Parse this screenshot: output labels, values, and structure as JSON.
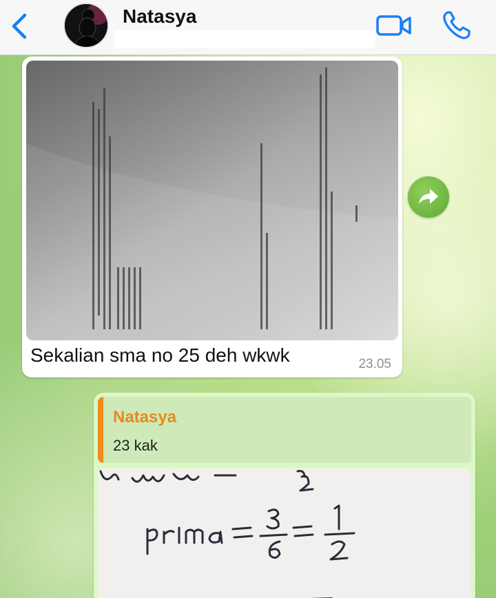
{
  "header": {
    "contact_name": "Natasya",
    "icons": {
      "back": "chevron-left-icon",
      "video": "video-call-icon",
      "phone": "phone-icon"
    },
    "accent_color": "#1a7ef5"
  },
  "messages": [
    {
      "direction": "incoming",
      "type": "photo",
      "caption": "Sekalian sma no 25 deh wkwk",
      "time": "23.05"
    },
    {
      "direction": "outgoing",
      "type": "photo",
      "reply_to": {
        "author": "Natasya",
        "text": "23 kak"
      }
    }
  ],
  "colors": {
    "outgoing_bubble": "#dcf8c6",
    "incoming_bubble": "#ffffff",
    "reply_bar": "#f08a1c",
    "reply_author": "#e8891e",
    "forward_button": "#6ab43f"
  }
}
